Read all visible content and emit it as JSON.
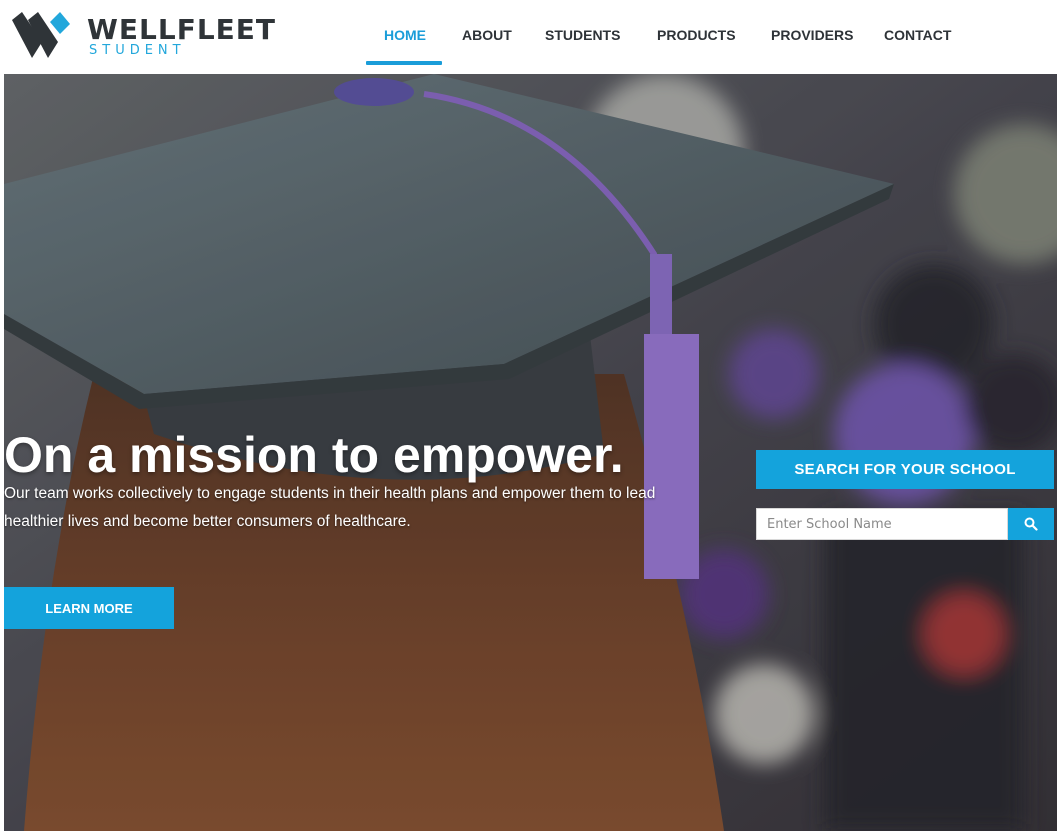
{
  "brand": {
    "name": "WELLFLEET",
    "sub": "STUDENT",
    "colors": {
      "accent": "#1a9dd9",
      "dark": "#2f3438"
    }
  },
  "nav": {
    "items": [
      {
        "label": "HOME",
        "active": true
      },
      {
        "label": "ABOUT"
      },
      {
        "label": "STUDENTS"
      },
      {
        "label": "PRODUCTS"
      },
      {
        "label": "PROVIDERS"
      },
      {
        "label": "CONTACT"
      }
    ]
  },
  "hero": {
    "title": "On a mission to empower.",
    "description": "Our team works collectively to engage students in their health plans and empower them to lead healthier lives and become better consumers of healthcare.",
    "cta_label": "LEARN MORE",
    "background": "graduation-cap-with-purple-tassel-photo"
  },
  "search": {
    "title": "SEARCH FOR YOUR SCHOOL",
    "placeholder": "Enter School Name",
    "value": "",
    "button_icon": "search-icon"
  }
}
